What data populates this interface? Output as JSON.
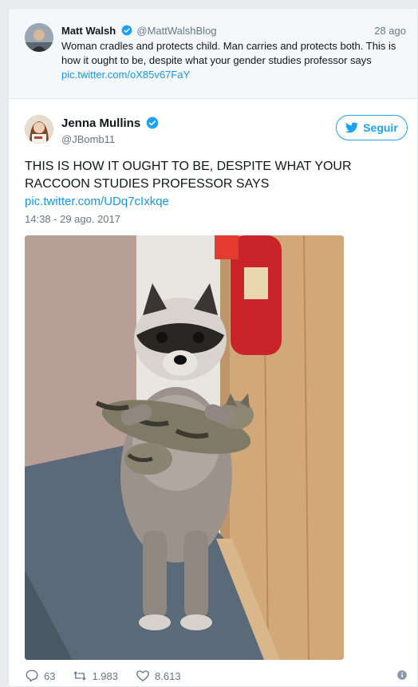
{
  "parent_tweet": {
    "author_name": "Matt Walsh",
    "author_handle": "@MattWalshBlog",
    "time_ago": "28 ago",
    "text_plain": "Woman cradles and protects child. Man carries and protects both. This is how it ought to be, despite what your gender studies professor says",
    "link": "pic.twitter.com/oX85v67FaY"
  },
  "tweet": {
    "author_name": "Jenna Mullins",
    "author_handle": "@JBomb11",
    "follow_label": "Seguir",
    "text": "THIS IS HOW IT OUGHT TO BE, DESPITE WHAT YOUR RACCOON STUDIES PROFESSOR SAYS",
    "link": "pic.twitter.com/UDq7cIxkqe",
    "timestamp": "14:38 - 29 ago. 2017"
  },
  "actions": {
    "replies": "63",
    "retweets": "1.983",
    "likes": "8.613"
  },
  "icons": {
    "reply": "reply-icon",
    "retweet": "retweet-icon",
    "like": "heart-icon",
    "info": "info-icon",
    "verified": "verified-badge-icon",
    "follow": "twitter-bird-icon"
  },
  "colors": {
    "accent": "#1da1f2",
    "link": "#1b95e0",
    "muted": "#657786",
    "parent_bg": "#f5f8fa"
  }
}
